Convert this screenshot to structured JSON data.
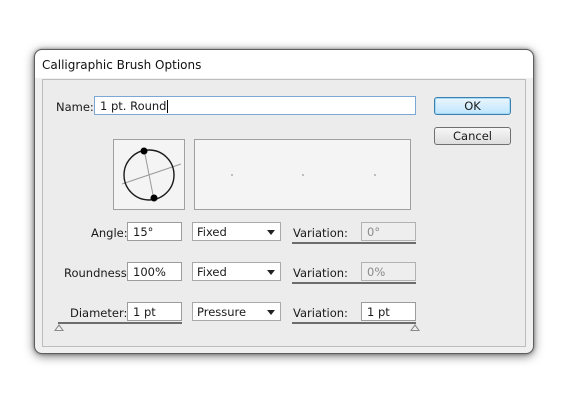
{
  "dialog": {
    "title": "Calligraphic Brush Options",
    "name_label": "Name:",
    "name_value": "1 pt. Round",
    "ok_label": "OK",
    "cancel_label": "Cancel"
  },
  "settings": [
    {
      "label": "Angle:",
      "value": "15°",
      "mode": "Fixed",
      "variation_label": "Variation:",
      "variation": "0°",
      "variation_enabled": false
    },
    {
      "label": "Roundness:",
      "value": "100%",
      "mode": "Fixed",
      "variation_label": "Variation:",
      "variation": "0%",
      "variation_enabled": false
    },
    {
      "label": "Diameter:",
      "value": "1 pt",
      "mode": "Pressure",
      "variation_label": "Variation:",
      "variation": "1 pt",
      "variation_enabled": true
    }
  ],
  "icons": {
    "brush_shape": "brush-shape-preview-icon",
    "dropdown": "chevron-down-icon",
    "slider_thumb": "slider-thumb-icon"
  },
  "colors": {
    "dialog_bg": "#f0f0f0",
    "ok_button": "#bee6fd",
    "field_border": "#9c9c9c"
  }
}
